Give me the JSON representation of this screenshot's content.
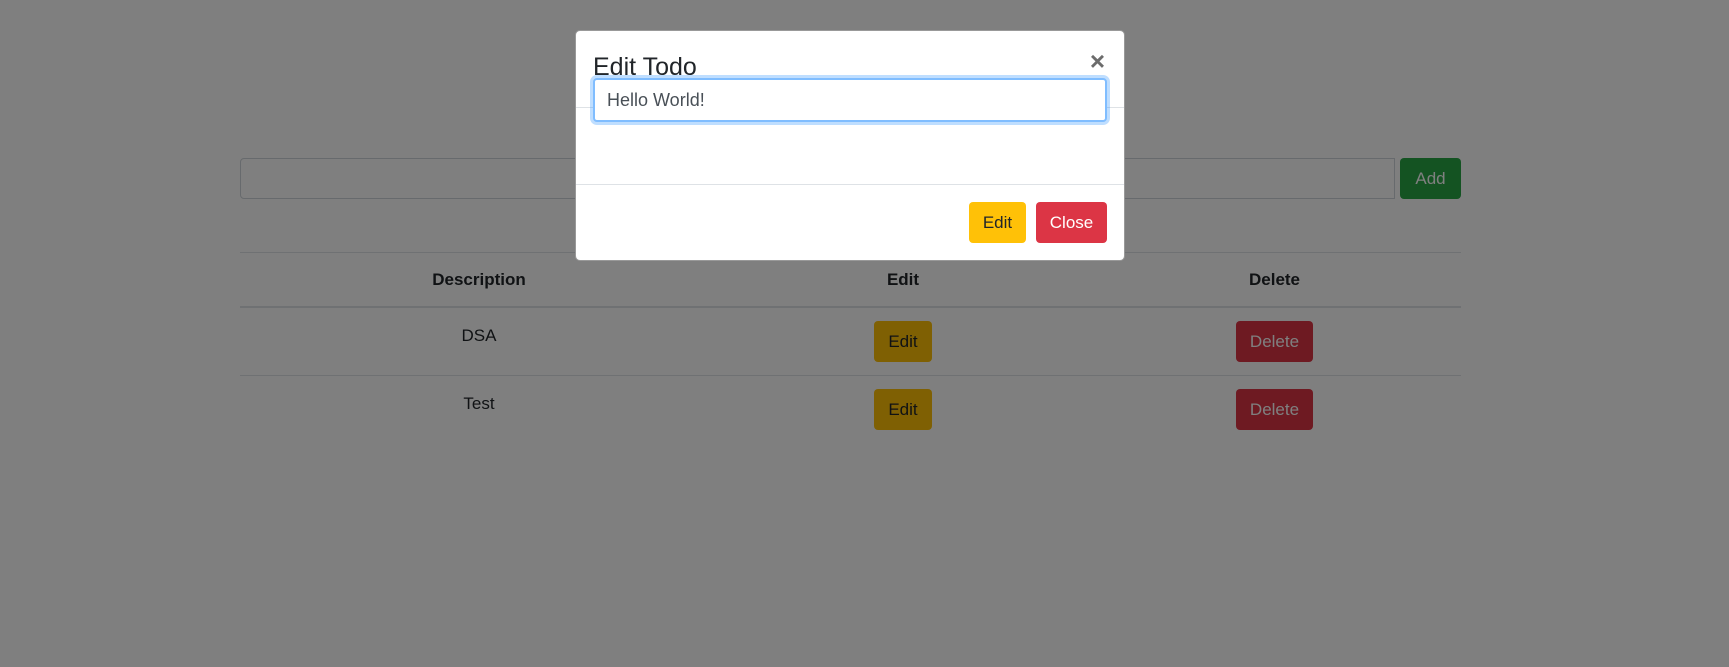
{
  "add_form": {
    "input_value": "",
    "add_label": "Add"
  },
  "table": {
    "headers": [
      "Description",
      "Edit",
      "Delete"
    ],
    "rows": [
      {
        "description": "DSA",
        "edit_label": "Edit",
        "delete_label": "Delete"
      },
      {
        "description": "Test",
        "edit_label": "Edit",
        "delete_label": "Delete"
      }
    ]
  },
  "modal": {
    "title": "Edit Todo",
    "close_icon": "×",
    "input_value": "Hello World!",
    "edit_label": "Edit",
    "close_label": "Close"
  },
  "colors": {
    "success": "#28a745",
    "warning": "#ffc107",
    "danger": "#dc3545",
    "focus": "#80bdff"
  }
}
